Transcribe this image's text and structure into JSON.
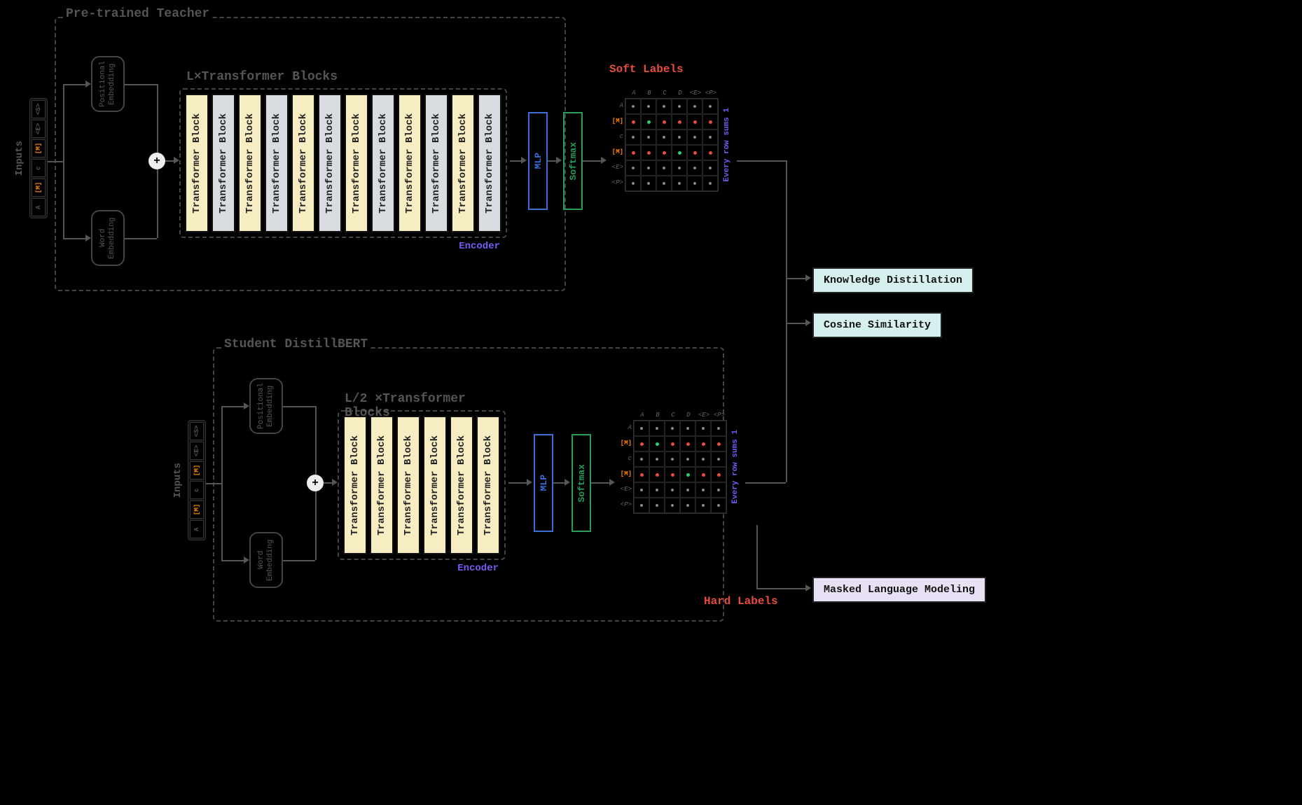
{
  "teacher": {
    "section_label": "Pre-trained Teacher",
    "inputs_label": "Inputs",
    "input_tokens": [
      "<S>",
      "<E>",
      "[M]",
      "c",
      "[M]",
      "A"
    ],
    "positional_embedding": "Positional Embedding",
    "word_embedding": "Word Embedding",
    "plus": "+",
    "encoder_title": "L×Transformer Blocks",
    "encoder_sub": "Encoder",
    "block_label": "Transformer Block",
    "num_blocks": 12,
    "mlp": "MLP",
    "softmax": "Softmax",
    "labels_title": "Soft Labels",
    "grid_cols": [
      "A",
      "B",
      "C",
      "D",
      "<E>",
      "<P>"
    ],
    "grid_rows": [
      "A",
      "[M]",
      "c",
      "[M]",
      "<E>",
      "<P>"
    ],
    "grid_side": "Every row sums 1"
  },
  "student": {
    "section_label": "Student DistillBERT",
    "inputs_label": "Inputs",
    "input_tokens": [
      "<S>",
      "<E>",
      "[M]",
      "c",
      "[M]",
      "A"
    ],
    "positional_embedding": "Positional Embedding",
    "word_embedding": "Word Embedding",
    "plus": "+",
    "encoder_title": "L/2 ×Transformer Blocks",
    "encoder_sub": "Encoder",
    "block_label": "Transformer Block",
    "num_blocks": 6,
    "mlp": "MLP",
    "softmax": "Softmax",
    "labels_title": "Hard Labels",
    "grid_cols": [
      "A",
      "B",
      "C",
      "D",
      "<E>",
      "<P>"
    ],
    "grid_rows": [
      "A",
      "[M]",
      "c",
      "[M]",
      "<E>",
      "<P>"
    ],
    "grid_side": "Every row sums 1"
  },
  "outputs": {
    "kd": "Knowledge Distillation",
    "cos": "Cosine Similarity",
    "mlm": "Masked Language Modeling"
  }
}
